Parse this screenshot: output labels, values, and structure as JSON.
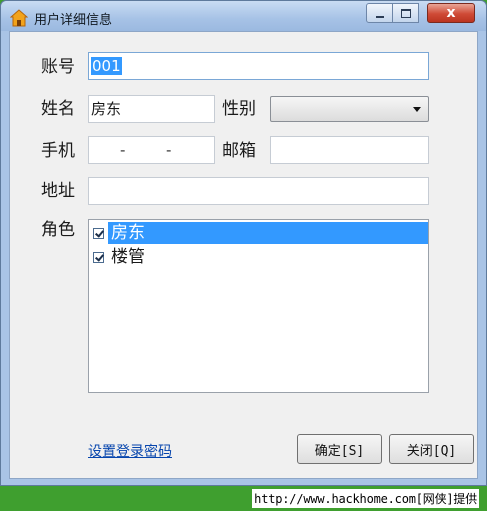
{
  "window": {
    "title": "用户详细信息",
    "close_glyph": "x"
  },
  "form": {
    "account_label": "账号",
    "account_value": "001",
    "name_label": "姓名",
    "name_value": "房东",
    "gender_label": "性别",
    "gender_value": "",
    "phone_label": "手机",
    "phone_sep_1": "-",
    "phone_sep_2": "-",
    "email_label": "邮箱",
    "email_value": "",
    "address_label": "地址",
    "address_value": "",
    "roles_label": "角色",
    "roles": [
      {
        "label": "房东",
        "checked": true,
        "selected": true
      },
      {
        "label": "楼管",
        "checked": true,
        "selected": false
      }
    ]
  },
  "actions": {
    "set_password_link": "设置登录密码",
    "confirm_button": "确定[S]",
    "close_button": "关闭[Q]"
  },
  "footer": {
    "watermark": "http://www.hackhome.com[网侠]提供"
  },
  "colors": {
    "selection": "#3399ff",
    "window_frame": "#a9c4e6",
    "close_button": "#cf4a36",
    "footer_bg": "#3f9f2f"
  }
}
